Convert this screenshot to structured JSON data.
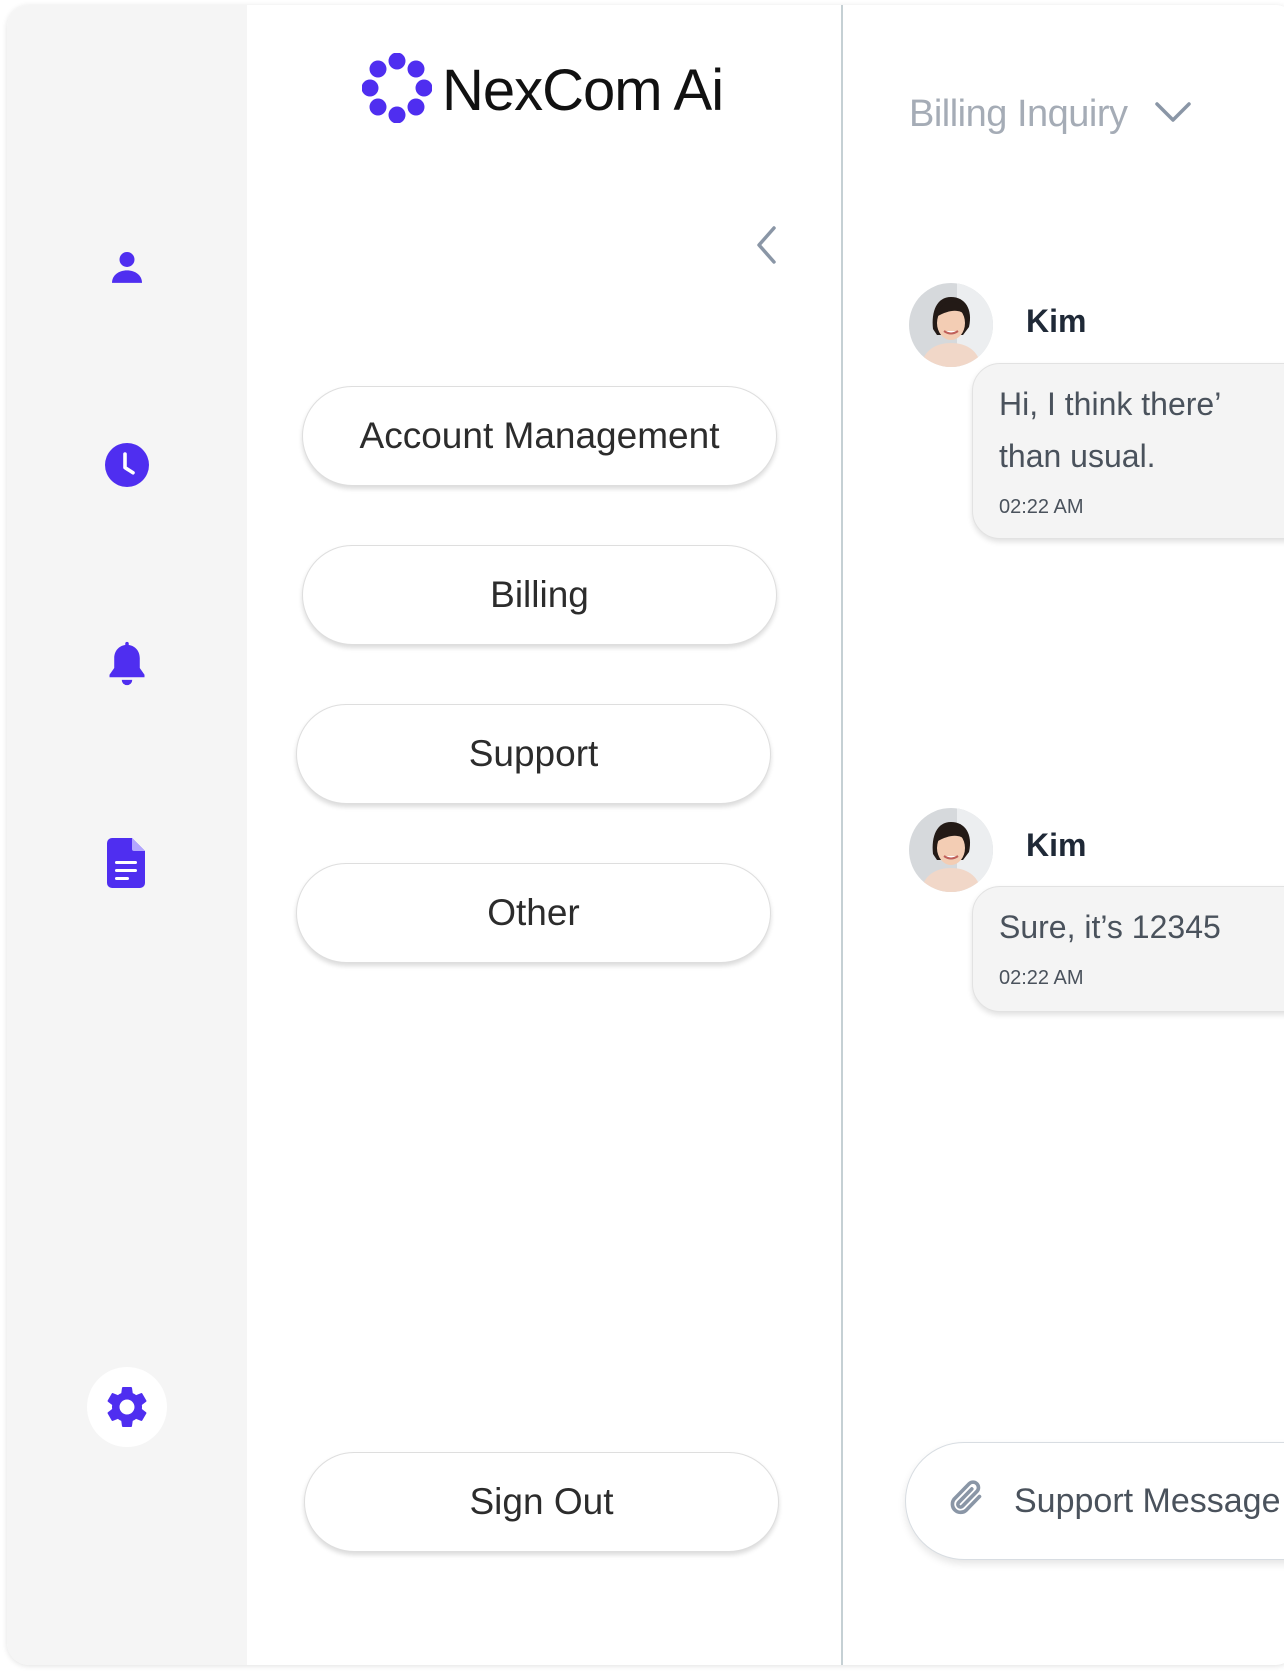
{
  "brand": {
    "name": "NexCom Ai",
    "logo_icon": "dot-ring-logo",
    "accent_color": "#4f2ef0"
  },
  "rail": {
    "items": [
      {
        "icon": "user-icon"
      },
      {
        "icon": "clock-icon"
      },
      {
        "icon": "bell-icon"
      },
      {
        "icon": "document-icon"
      }
    ],
    "settings_icon": "gear-icon"
  },
  "menu": {
    "collapse_icon": "chevron-left-icon",
    "options": [
      "Account Management",
      "Billing",
      "Support",
      "Other"
    ],
    "sign_out_label": "Sign Out"
  },
  "chat": {
    "topic": "Billing Inquiry",
    "messages": [
      {
        "sender": "Kim",
        "lines": [
          "Hi, I think there’",
          "than usual."
        ],
        "time": "02:22 AM"
      },
      {
        "sender": "Kim",
        "lines": [
          "Sure, it’s 12345"
        ],
        "time": "02:22 AM"
      }
    ],
    "composer": {
      "placeholder": "Support Message",
      "attach_icon": "paperclip-icon"
    }
  }
}
